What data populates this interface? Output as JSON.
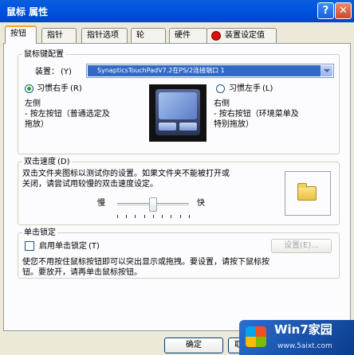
{
  "window": {
    "title": "鼠标 属性",
    "help": "?",
    "close": "✕"
  },
  "tabs": [
    "按钮",
    "指针",
    "指针选项",
    "轮",
    "硬件",
    "装置设定值"
  ],
  "button_config": {
    "legend": "鼠标键配置",
    "device_label": "装置：",
    "device_accel": "(Y)",
    "device_value": "SynapticsTouchPadV7.2在PS/2连接端口 1",
    "right_hand": "习惯右手",
    "right_hand_key": "(R)",
    "left_hand": "习惯左手",
    "left_hand_key": "(L)",
    "left_title": "左侧",
    "left_desc_1": "- 按左按钮（普通选定及",
    "left_desc_2": "拖放）",
    "right_title": "右侧",
    "right_desc_1": "- 按右按钮（环境菜单及",
    "right_desc_2": "特别拖放）"
  },
  "double_click": {
    "legend": "双击速度",
    "legend_key": "(D)",
    "desc_1": "双击文件夹图标以测试你的设置。如果文件夹不能被打开或",
    "desc_2": "关闭，请尝试用较慢的双击速度设定。",
    "slow": "慢",
    "fast": "快",
    "speed_fraction": 0.5
  },
  "click_lock": {
    "legend": "单击锁定",
    "enable": "启用单击锁定",
    "enable_key": "(T)",
    "settings": "设置(E)...",
    "desc_1": "使您不用按住鼠标按钮即可以突出显示或拖拽。要设置，请按下鼠标按",
    "desc_2": "钮。要放开，请再单击鼠标按钮。"
  },
  "footer": {
    "ok": "确定",
    "cancel": "取消"
  },
  "watermark": {
    "brand": "Win7家园",
    "url": "www.5aixt.com"
  }
}
